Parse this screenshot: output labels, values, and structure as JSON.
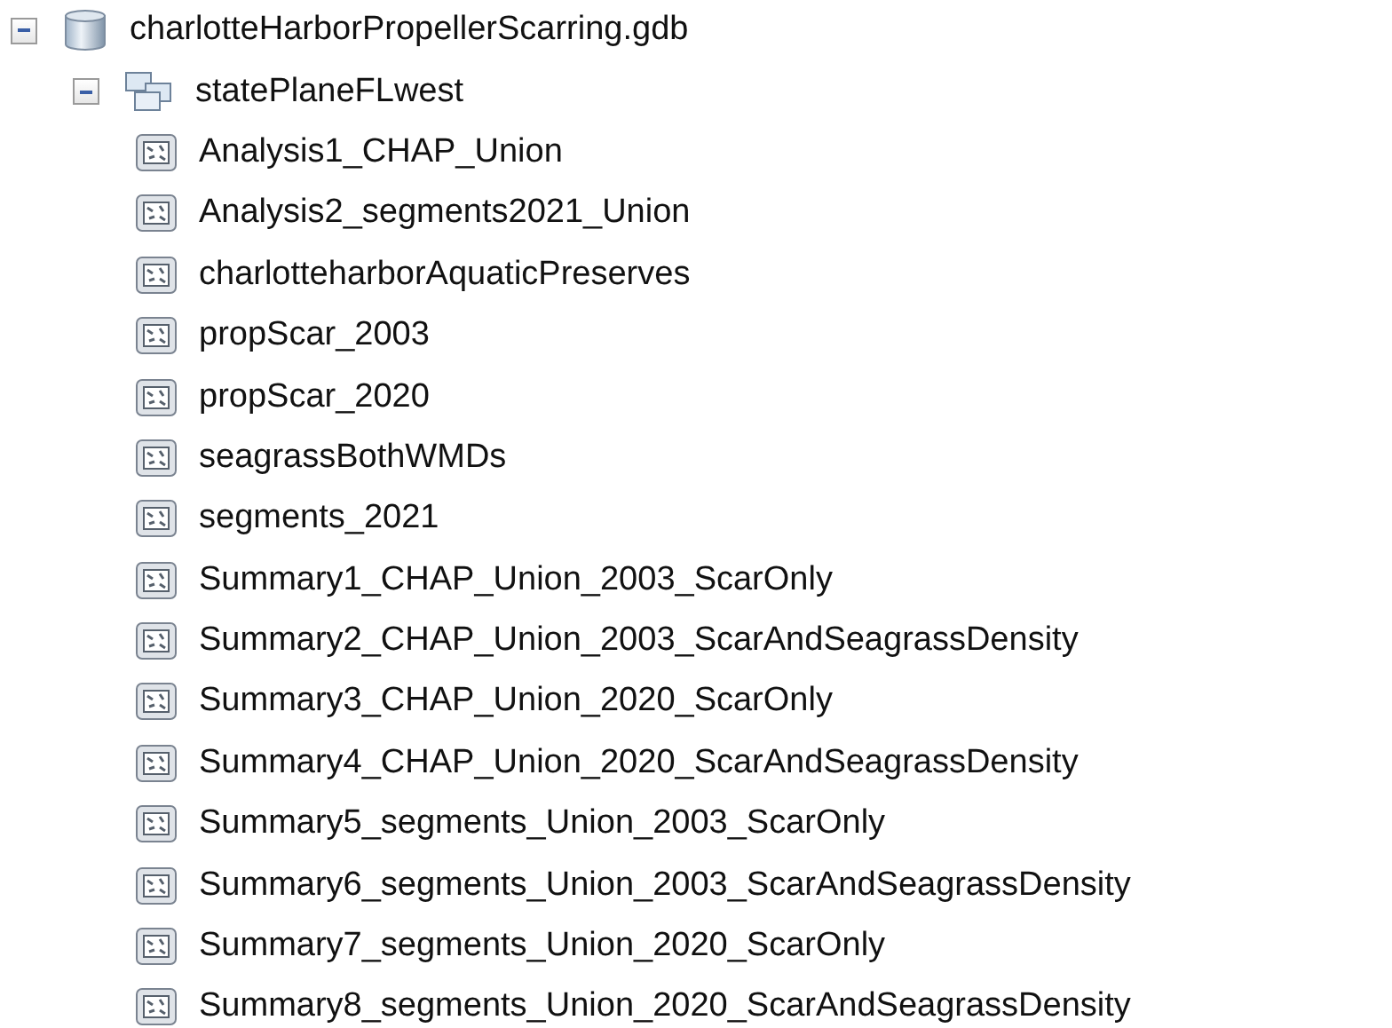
{
  "tree": [
    {
      "kind": "database",
      "label": "charlotteHarborPropellerScarring.gdb",
      "expanded": true,
      "children": [
        {
          "kind": "dataset",
          "label": "statePlaneFLwest",
          "expanded": true,
          "children": [
            {
              "kind": "feature_class",
              "label": "Analysis1_CHAP_Union"
            },
            {
              "kind": "feature_class",
              "label": "Analysis2_segments2021_Union"
            },
            {
              "kind": "feature_class",
              "label": "charlotteharborAquaticPreserves"
            },
            {
              "kind": "feature_class",
              "label": "propScar_2003"
            },
            {
              "kind": "feature_class",
              "label": "propScar_2020"
            },
            {
              "kind": "feature_class",
              "label": "seagrassBothWMDs"
            },
            {
              "kind": "feature_class",
              "label": "segments_2021"
            },
            {
              "kind": "feature_class",
              "label": "Summary1_CHAP_Union_2003_ScarOnly"
            },
            {
              "kind": "feature_class",
              "label": "Summary2_CHAP_Union_2003_ScarAndSeagrassDensity"
            },
            {
              "kind": "feature_class",
              "label": "Summary3_CHAP_Union_2020_ScarOnly"
            },
            {
              "kind": "feature_class",
              "label": "Summary4_CHAP_Union_2020_ScarAndSeagrassDensity"
            },
            {
              "kind": "feature_class",
              "label": "Summary5_segments_Union_2003_ScarOnly"
            },
            {
              "kind": "feature_class",
              "label": "Summary6_segments_Union_2003_ScarAndSeagrassDensity"
            },
            {
              "kind": "feature_class",
              "label": "Summary7_segments_Union_2020_ScarOnly"
            },
            {
              "kind": "feature_class",
              "label": "Summary8_segments_Union_2020_ScarAndSeagrassDensity"
            }
          ]
        }
      ]
    }
  ]
}
